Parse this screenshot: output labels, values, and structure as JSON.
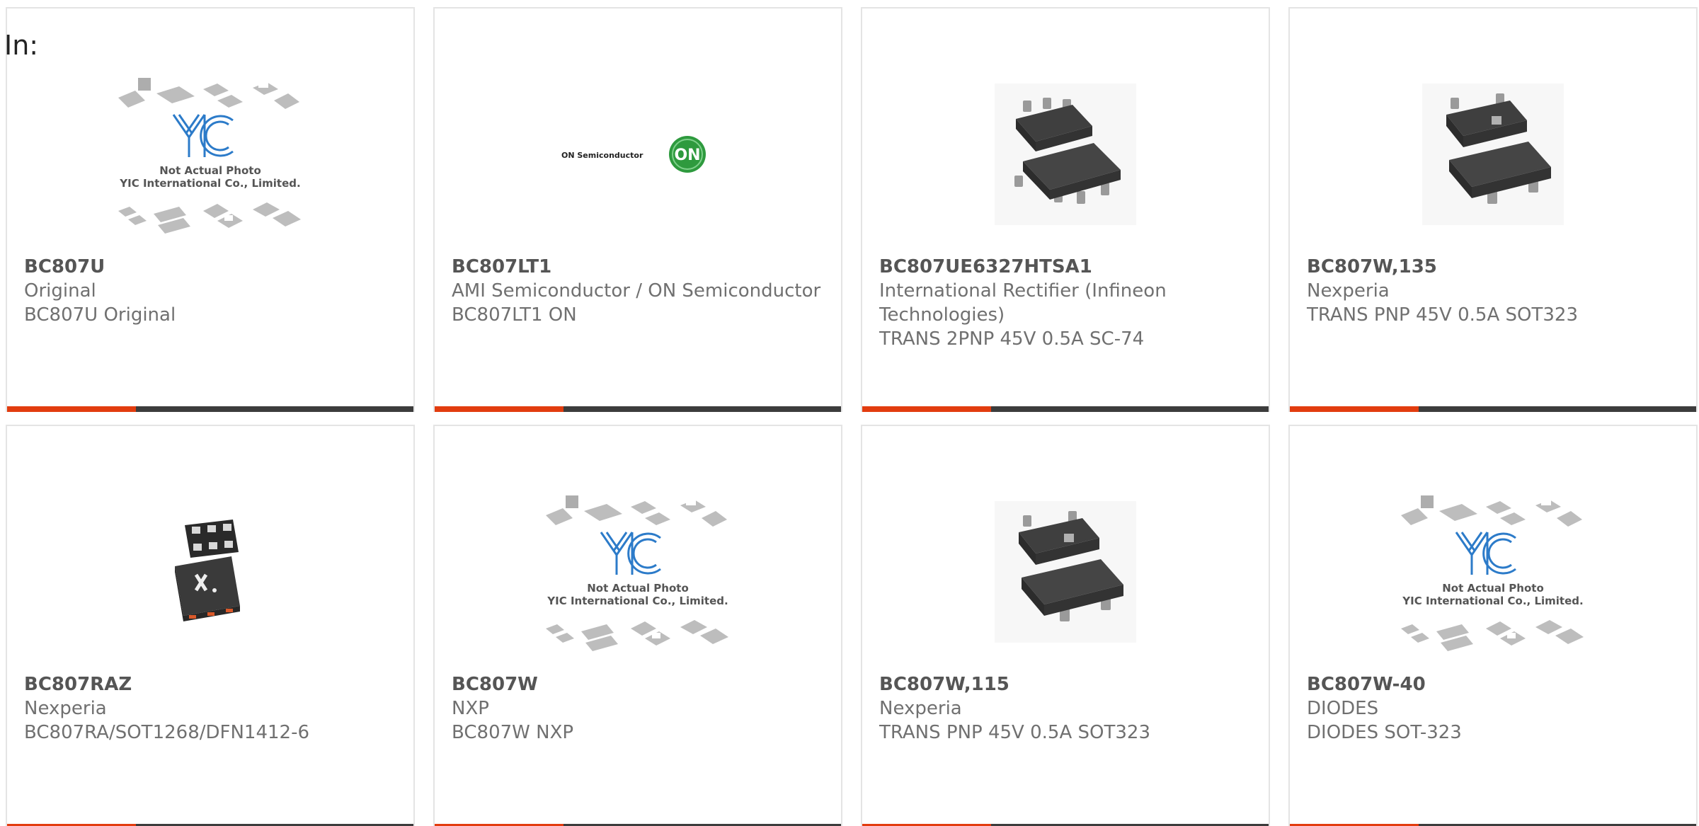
{
  "filter": {
    "label": "In:"
  },
  "colors": {
    "accent": "#e23c0f",
    "bar": "#3c3c3c"
  },
  "products": [
    {
      "part": "BC807U",
      "manufacturer": "Original",
      "description": "BC807U Original",
      "image": "placeholder-logo",
      "placeholder_line1": "Not Actual Photo",
      "placeholder_line2": "YIC International Co., Limited."
    },
    {
      "part": "BC807LT1",
      "manufacturer": "AMI Semiconductor / ON Semiconductor",
      "description": "BC807LT1 ON",
      "image": "on-semiconductor-logo",
      "brand_text": "ON Semiconductor",
      "brand_badge": "ON"
    },
    {
      "part": "BC807UE6327HTSA1",
      "manufacturer": "International Rectifier (Infineon Technologies)",
      "description": "TRANS 2PNP 45V 0.5A SC-74",
      "image": "sc74-package-photo"
    },
    {
      "part": "BC807W,135",
      "manufacturer": "Nexperia",
      "description": "TRANS PNP 45V 0.5A SOT323",
      "image": "sot323-package-photo"
    },
    {
      "part": "BC807RAZ",
      "manufacturer": "Nexperia",
      "description": "BC807RA/SOT1268/DFN1412-6",
      "image": "dfn-package-photo"
    },
    {
      "part": "BC807W",
      "manufacturer": "NXP",
      "description": "BC807W NXP",
      "image": "placeholder-logo",
      "placeholder_line1": "Not Actual Photo",
      "placeholder_line2": "YIC International Co., Limited."
    },
    {
      "part": "BC807W,115",
      "manufacturer": "Nexperia",
      "description": "TRANS PNP 45V 0.5A SOT323",
      "image": "sot323-package-photo"
    },
    {
      "part": "BC807W-40",
      "manufacturer": "DIODES",
      "description": "DIODES SOT-323",
      "image": "placeholder-logo",
      "placeholder_line1": "Not Actual Photo",
      "placeholder_line2": "YIC International Co., Limited."
    }
  ]
}
